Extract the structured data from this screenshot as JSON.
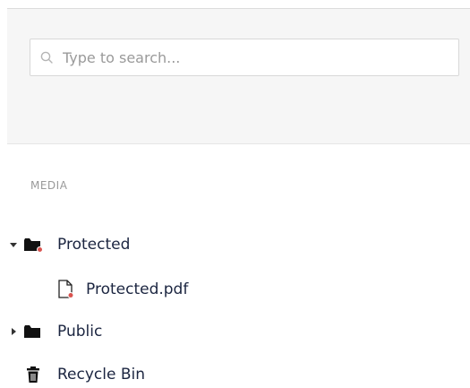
{
  "search": {
    "placeholder": "Type to search..."
  },
  "section": {
    "label": "MEDIA"
  },
  "tree": {
    "items": [
      {
        "label": "Protected",
        "icon": "folder-protected-icon",
        "expanded": true
      },
      {
        "label": "Protected.pdf",
        "icon": "file-protected-icon"
      },
      {
        "label": "Public",
        "icon": "folder-icon",
        "expanded": false
      },
      {
        "label": "Recycle Bin",
        "icon": "trash-icon"
      }
    ]
  },
  "colors": {
    "panel_bg": "#f6f6f6",
    "text": "#1b2540",
    "muted": "#9a9a9a",
    "protected_badge": "#d9534f"
  }
}
